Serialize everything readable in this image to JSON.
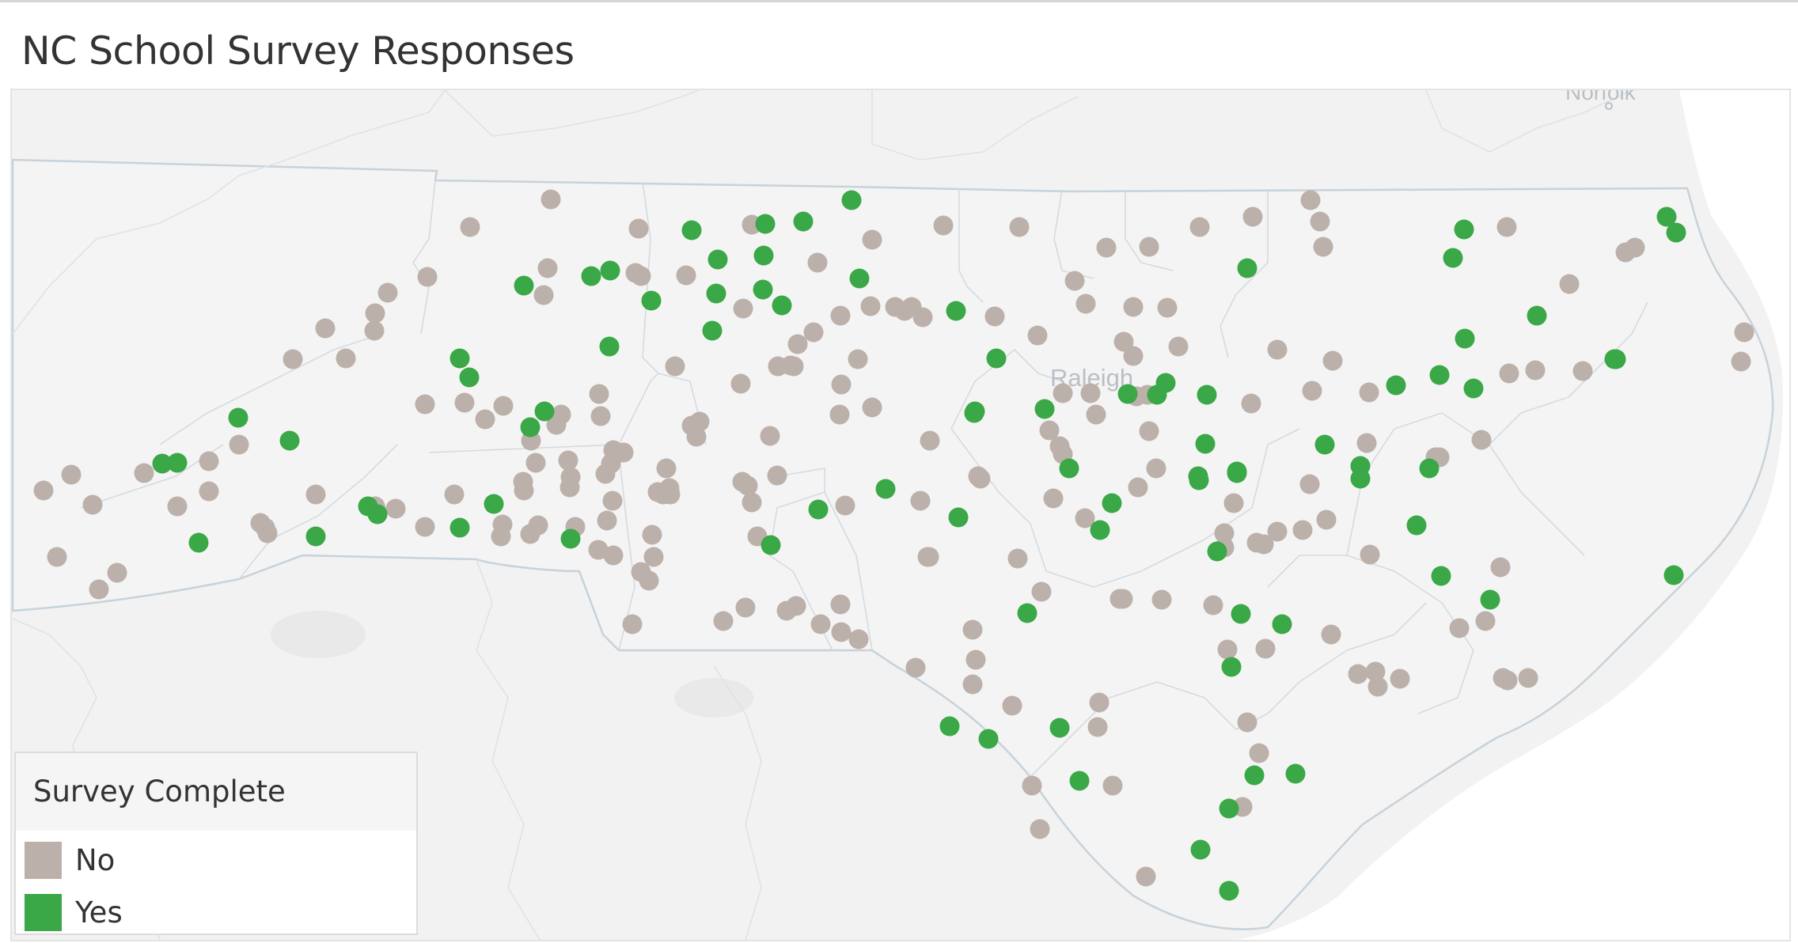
{
  "title": "NC School Survey Responses",
  "colors": {
    "no": "#bcb0aa",
    "yes": "#3aa847",
    "land": "#f2f2f2",
    "sea": "#ffffff",
    "border": "#d5dde3"
  },
  "map": {
    "place_labels": [
      "Raleigh",
      "Norfolk"
    ]
  },
  "legend": {
    "title": "Survey Complete",
    "items": [
      {
        "label": "No",
        "color": "#bcb0aa"
      },
      {
        "label": "Yes",
        "color": "#3aa847"
      }
    ]
  },
  "marks_no": [
    [
      694,
      250
    ],
    [
      592,
      285
    ],
    [
      805,
      287
    ],
    [
      948,
      282
    ],
    [
      1190,
      283
    ],
    [
      1286,
      285
    ],
    [
      1100,
      301
    ],
    [
      1396,
      311
    ],
    [
      1450,
      310
    ],
    [
      1514,
      285
    ],
    [
      1581,
      272
    ],
    [
      1654,
      251
    ],
    [
      1666,
      278
    ],
    [
      1670,
      310
    ],
    [
      1902,
      285
    ],
    [
      538,
      348
    ],
    [
      488,
      368
    ],
    [
      690,
      337
    ],
    [
      801,
      343
    ],
    [
      808,
      347
    ],
    [
      865,
      346
    ],
    [
      937,
      388
    ],
    [
      1031,
      330
    ],
    [
      1356,
      353
    ],
    [
      1370,
      382
    ],
    [
      1430,
      386
    ],
    [
      1473,
      387
    ],
    [
      472,
      394
    ],
    [
      471,
      416
    ],
    [
      409,
      413
    ],
    [
      685,
      371
    ],
    [
      1060,
      397
    ],
    [
      1098,
      385
    ],
    [
      1129,
      386
    ],
    [
      1141,
      391
    ],
    [
      1150,
      386
    ],
    [
      1164,
      399
    ],
    [
      1255,
      398
    ],
    [
      1309,
      422
    ],
    [
      1418,
      430
    ],
    [
      1430,
      448
    ],
    [
      1487,
      436
    ],
    [
      1612,
      440
    ],
    [
      1682,
      454
    ],
    [
      1981,
      357
    ],
    [
      2052,
      317
    ],
    [
      2064,
      311
    ],
    [
      2202,
      418
    ],
    [
      2198,
      455
    ],
    [
      1026,
      418
    ],
    [
      1006,
      433
    ],
    [
      997,
      460
    ],
    [
      1001,
      461
    ],
    [
      981,
      461
    ],
    [
      1082,
      452
    ],
    [
      851,
      461
    ],
    [
      1905,
      470
    ],
    [
      1938,
      466
    ],
    [
      1998,
      467
    ],
    [
      1061,
      484
    ],
    [
      1100,
      513
    ],
    [
      1059,
      522
    ],
    [
      934,
      483
    ],
    [
      1341,
      495
    ],
    [
      1376,
      495
    ],
    [
      1383,
      522
    ],
    [
      1434,
      499
    ],
    [
      1448,
      497
    ],
    [
      1579,
      508
    ],
    [
      1656,
      492
    ],
    [
      1728,
      494
    ],
    [
      368,
      452
    ],
    [
      435,
      451
    ],
    [
      535,
      509
    ],
    [
      585,
      507
    ],
    [
      634,
      511
    ],
    [
      757,
      524
    ],
    [
      755,
      496
    ],
    [
      707,
      522
    ],
    [
      701,
      535
    ],
    [
      669,
      555
    ],
    [
      611,
      528
    ],
    [
      675,
      583
    ],
    [
      716,
      580
    ],
    [
      770,
      584
    ],
    [
      786,
      570
    ],
    [
      719,
      601
    ],
    [
      718,
      614
    ],
    [
      773,
      567
    ],
    [
      763,
      597
    ],
    [
      772,
      631
    ],
    [
      840,
      590
    ],
    [
      829,
      620
    ],
    [
      845,
      623
    ],
    [
      882,
      531
    ],
    [
      872,
      536
    ],
    [
      878,
      550
    ],
    [
      971,
      549
    ],
    [
      1173,
      555
    ],
    [
      1324,
      542
    ],
    [
      1337,
      562
    ],
    [
      1341,
      572
    ],
    [
      1450,
      543
    ],
    [
      1725,
      558
    ],
    [
      1870,
      554
    ],
    [
      1812,
      576
    ],
    [
      262,
      619
    ],
    [
      300,
      560
    ],
    [
      262,
      581
    ],
    [
      88,
      598
    ],
    [
      53,
      618
    ],
    [
      115,
      636
    ],
    [
      180,
      596
    ],
    [
      222,
      638
    ],
    [
      70,
      702
    ],
    [
      146,
      722
    ],
    [
      123,
      743
    ],
    [
      327,
      659
    ],
    [
      336,
      672
    ],
    [
      333,
      665
    ],
    [
      397,
      623
    ],
    [
      472,
      638
    ],
    [
      498,
      641
    ],
    [
      473,
      641
    ],
    [
      535,
      664
    ],
    [
      572,
      623
    ],
    [
      659,
      607
    ],
    [
      660,
      618
    ],
    [
      633,
      661
    ],
    [
      678,
      662
    ],
    [
      631,
      676
    ],
    [
      668,
      673
    ],
    [
      725,
      664
    ],
    [
      765,
      656
    ],
    [
      754,
      693
    ],
    [
      822,
      674
    ],
    [
      824,
      702
    ],
    [
      773,
      700
    ],
    [
      808,
      721
    ],
    [
      818,
      732
    ],
    [
      844,
      615
    ],
    [
      836,
      623
    ],
    [
      936,
      607
    ],
    [
      980,
      599
    ],
    [
      943,
      612
    ],
    [
      948,
      633
    ],
    [
      955,
      676
    ],
    [
      1066,
      637
    ],
    [
      1237,
      603
    ],
    [
      1161,
      631
    ],
    [
      1170,
      702
    ],
    [
      1234,
      600
    ],
    [
      1329,
      628
    ],
    [
      1369,
      653
    ],
    [
      1436,
      614
    ],
    [
      1459,
      590
    ],
    [
      1557,
      634
    ],
    [
      1545,
      672
    ],
    [
      1545,
      690
    ],
    [
      1586,
      684
    ],
    [
      1595,
      686
    ],
    [
      1612,
      670
    ],
    [
      1674,
      655
    ],
    [
      1644,
      668
    ],
    [
      1653,
      610
    ],
    [
      1817,
      576
    ],
    [
      1729,
      699
    ],
    [
      1894,
      715
    ],
    [
      1875,
      783
    ],
    [
      912,
      783
    ],
    [
      940,
      766
    ],
    [
      1004,
      764
    ],
    [
      992,
      770
    ],
    [
      1060,
      762
    ],
    [
      1035,
      787
    ],
    [
      1061,
      797
    ],
    [
      1083,
      806
    ],
    [
      1172,
      702
    ],
    [
      1227,
      794
    ],
    [
      1413,
      755
    ],
    [
      1284,
      704
    ],
    [
      1314,
      746
    ],
    [
      1417,
      755
    ],
    [
      1466,
      756
    ],
    [
      1531,
      763
    ],
    [
      1597,
      818
    ],
    [
      1680,
      800
    ],
    [
      1736,
      847
    ],
    [
      1767,
      856
    ],
    [
      1714,
      850
    ],
    [
      1739,
      866
    ],
    [
      1897,
      855
    ],
    [
      1842,
      792
    ],
    [
      1903,
      858
    ],
    [
      1929,
      855
    ],
    [
      1231,
      832
    ],
    [
      1155,
      842
    ],
    [
      1227,
      863
    ],
    [
      1277,
      890
    ],
    [
      1387,
      886
    ],
    [
      1549,
      819
    ],
    [
      1574,
      911
    ],
    [
      1589,
      950
    ],
    [
      1302,
      991
    ],
    [
      1404,
      991
    ],
    [
      1312,
      1046
    ],
    [
      1568,
      1018
    ],
    [
      1446,
      1106
    ],
    [
      1385,
      917
    ],
    [
      797,
      787
    ]
  ],
  "marks_yes": [
    [
      1074,
      251
    ],
    [
      1013,
      278
    ],
    [
      872,
      289
    ],
    [
      965,
      281
    ],
    [
      1084,
      350
    ],
    [
      905,
      326
    ],
    [
      963,
      321
    ],
    [
      660,
      359
    ],
    [
      745,
      347
    ],
    [
      769,
      340
    ],
    [
      821,
      378
    ],
    [
      903,
      369
    ],
    [
      962,
      364
    ],
    [
      986,
      384
    ],
    [
      898,
      416
    ],
    [
      1206,
      391
    ],
    [
      1257,
      451
    ],
    [
      1848,
      288
    ],
    [
      1834,
      324
    ],
    [
      1940,
      397
    ],
    [
      2104,
      272
    ],
    [
      2116,
      292
    ],
    [
      1574,
      337
    ],
    [
      768,
      436
    ],
    [
      579,
      451
    ],
    [
      591,
      475
    ],
    [
      1849,
      426
    ],
    [
      1762,
      485
    ],
    [
      1817,
      472
    ],
    [
      1860,
      489
    ],
    [
      2040,
      452
    ],
    [
      1318,
      515
    ],
    [
      1230,
      518
    ],
    [
      1423,
      496
    ],
    [
      1460,
      497
    ],
    [
      1471,
      482
    ],
    [
      1523,
      497
    ],
    [
      1229,
      520
    ],
    [
      1521,
      559
    ],
    [
      1561,
      596
    ],
    [
      2038,
      452
    ],
    [
      686,
      518
    ],
    [
      668,
      538
    ],
    [
      299,
      526
    ],
    [
      364,
      555
    ],
    [
      203,
      584
    ],
    [
      222,
      583
    ],
    [
      463,
      638
    ],
    [
      475,
      648
    ],
    [
      622,
      635
    ],
    [
      579,
      665
    ],
    [
      719,
      679
    ],
    [
      1032,
      642
    ],
    [
      1117,
      616
    ],
    [
      972,
      687
    ],
    [
      1209,
      652
    ],
    [
      1349,
      590
    ],
    [
      1403,
      634
    ],
    [
      1388,
      668
    ],
    [
      1512,
      600
    ],
    [
      1561,
      594
    ],
    [
      1513,
      605
    ],
    [
      1672,
      560
    ],
    [
      1717,
      587
    ],
    [
      1717,
      603
    ],
    [
      1804,
      590
    ],
    [
      1536,
      695
    ],
    [
      1296,
      773
    ],
    [
      1788,
      662
    ],
    [
      1819,
      726
    ],
    [
      1881,
      756
    ],
    [
      2113,
      725
    ],
    [
      249,
      684
    ],
    [
      397,
      676
    ],
    [
      1566,
      774
    ],
    [
      1618,
      787
    ],
    [
      1554,
      841
    ],
    [
      1198,
      916
    ],
    [
      1247,
      932
    ],
    [
      1337,
      918
    ],
    [
      1362,
      985
    ],
    [
      1583,
      978
    ],
    [
      1635,
      976
    ],
    [
      1551,
      1020
    ],
    [
      1515,
      1072
    ],
    [
      1551,
      1124
    ]
  ]
}
